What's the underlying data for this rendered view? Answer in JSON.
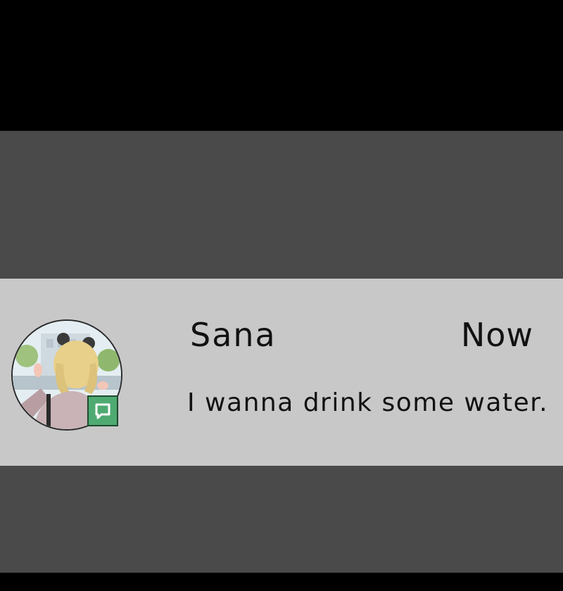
{
  "notification": {
    "sender": "Sana",
    "time": "Now",
    "message": "I wanna drink some water.",
    "avatar_icon": "profile-avatar",
    "badge_icon": "chat-bubble-icon"
  },
  "colors": {
    "background": "#000000",
    "band": "#4a4a4a",
    "card": "#c8c8c8",
    "badge": "#4faa72",
    "text": "#111111"
  }
}
